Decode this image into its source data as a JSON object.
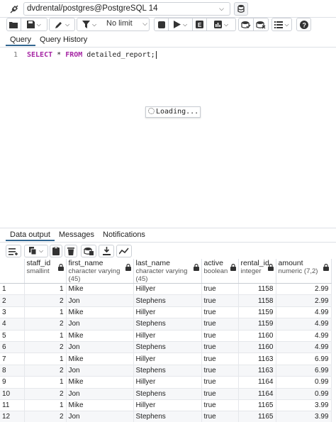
{
  "connection": {
    "label": "dvdrental/postgres@PostgreSQL 14"
  },
  "toolbar": {
    "limit_label": "No limit"
  },
  "editor_tabs": [
    {
      "label": "Query"
    },
    {
      "label": "Query History"
    }
  ],
  "editor": {
    "line_number": "1",
    "keyword_select": "SELECT",
    "star": " * ",
    "keyword_from": "FROM",
    "rest": " detailed_report;",
    "autocomplete_text": "Loading..."
  },
  "output_tabs": [
    {
      "label": "Data output"
    },
    {
      "label": "Messages"
    },
    {
      "label": "Notifications"
    }
  ],
  "grid": {
    "columns": [
      {
        "name": "staff_id",
        "type": "smallint"
      },
      {
        "name": "first_name",
        "type": "character varying (45)"
      },
      {
        "name": "last_name",
        "type": "character varying (45)"
      },
      {
        "name": "active",
        "type": "boolean"
      },
      {
        "name": "rental_id",
        "type": "integer"
      },
      {
        "name": "amount",
        "type": "numeric (7,2)"
      }
    ],
    "rows": [
      [
        "1",
        "1",
        "Mike",
        "Hillyer",
        "true",
        "1158",
        "2.99"
      ],
      [
        "2",
        "2",
        "Jon",
        "Stephens",
        "true",
        "1158",
        "2.99"
      ],
      [
        "3",
        "1",
        "Mike",
        "Hillyer",
        "true",
        "1159",
        "4.99"
      ],
      [
        "4",
        "2",
        "Jon",
        "Stephens",
        "true",
        "1159",
        "4.99"
      ],
      [
        "5",
        "1",
        "Mike",
        "Hillyer",
        "true",
        "1160",
        "4.99"
      ],
      [
        "6",
        "2",
        "Jon",
        "Stephens",
        "true",
        "1160",
        "4.99"
      ],
      [
        "7",
        "1",
        "Mike",
        "Hillyer",
        "true",
        "1163",
        "6.99"
      ],
      [
        "8",
        "2",
        "Jon",
        "Stephens",
        "true",
        "1163",
        "6.99"
      ],
      [
        "9",
        "1",
        "Mike",
        "Hillyer",
        "true",
        "1164",
        "0.99"
      ],
      [
        "10",
        "2",
        "Jon",
        "Stephens",
        "true",
        "1164",
        "0.99"
      ],
      [
        "11",
        "1",
        "Mike",
        "Hillyer",
        "true",
        "1165",
        "3.99"
      ],
      [
        "12",
        "2",
        "Jon",
        "Stephens",
        "true",
        "1165",
        "3.99"
      ]
    ]
  },
  "colors": {
    "keyword": "#a626a4",
    "accent": "#326690",
    "border": "#dde0e6"
  }
}
